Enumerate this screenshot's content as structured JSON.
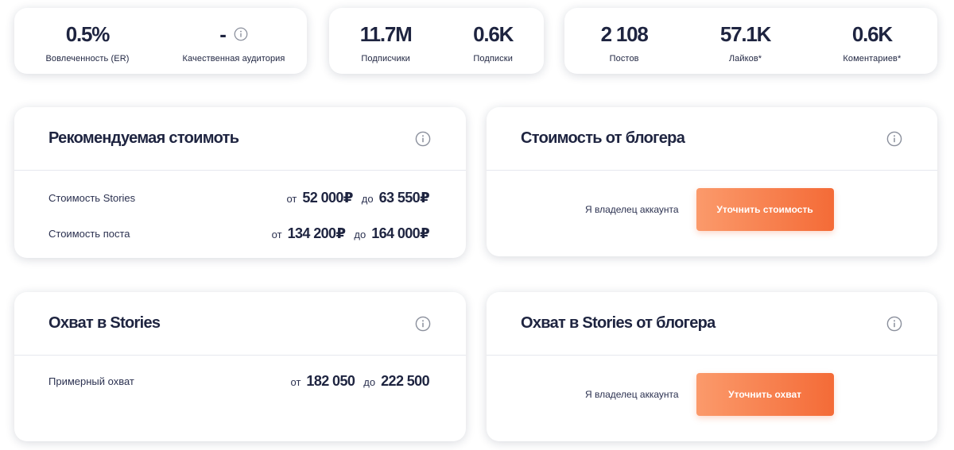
{
  "stats_card_1": {
    "engagement": {
      "value": "0.5%",
      "label": "Вовлеченность (ER)"
    },
    "quality": {
      "value": "-",
      "label": "Качественная аудитория"
    }
  },
  "stats_card_2": {
    "subscribers": {
      "value": "11.7M",
      "label": "Подписчики"
    },
    "subscriptions": {
      "value": "0.6K",
      "label": "Подписки"
    }
  },
  "stats_card_3": {
    "posts": {
      "value": "2 108",
      "label": "Постов"
    },
    "likes": {
      "value": "57.1K",
      "label": "Лайков*"
    },
    "comments": {
      "value": "0.6K",
      "label": "Коментариев*"
    }
  },
  "recommended_cost": {
    "title": "Рекомендуемая стоимоть",
    "rows": [
      {
        "label": "Стоимость Stories",
        "from_word": "от",
        "from": "52 000₽",
        "to_word": "до",
        "to": "63 550₽"
      },
      {
        "label": "Стоимость поста",
        "from_word": "от",
        "from": "134 200₽",
        "to_word": "до",
        "to": "164 000₽"
      }
    ]
  },
  "blogger_cost": {
    "title": "Стоимость от блогера",
    "owner_label": "Я владелец аккаунта",
    "button": "Уточнить стоимость"
  },
  "stories_reach": {
    "title": "Охват в Stories",
    "row": {
      "label": "Примерный охват",
      "from_word": "от",
      "from": "182 050",
      "to_word": "до",
      "to": "222 500"
    }
  },
  "blogger_reach": {
    "title": "Охват в Stories от блогера",
    "owner_label": "Я владелец аккаунта",
    "button": "Уточнить охват"
  },
  "icons": {
    "info": "info-circle-icon"
  },
  "colors": {
    "text": "#1e2440",
    "accent_start": "#fb9a6b",
    "accent_end": "#f46b37",
    "icon": "#8a8f9c"
  }
}
